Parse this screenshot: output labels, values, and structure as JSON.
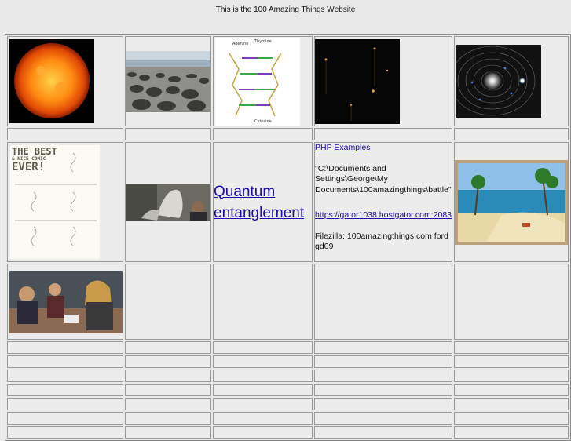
{
  "page": {
    "title": "This is the 100 Amazing Things Website"
  },
  "links": {
    "quantum": "Quantum entanglement",
    "php": "PHP Examples",
    "hostgator": "https://gator1038.hostgator.com:2083"
  },
  "notes": {
    "path": "\"C:\\Documents and Settings\\George\\My Documents\\100amazingthings\\battle\"",
    "filezilla": "Filezilla:  100amazingthings.com ford gd09"
  },
  "comic": {
    "line1": "THE BEST",
    "line2": "& NICE COMIC",
    "line3": "EVER!"
  },
  "diagram": {
    "label_top_left": "Adenine",
    "label_top_right": "Thymine",
    "label_bottom": "Cytosine"
  }
}
